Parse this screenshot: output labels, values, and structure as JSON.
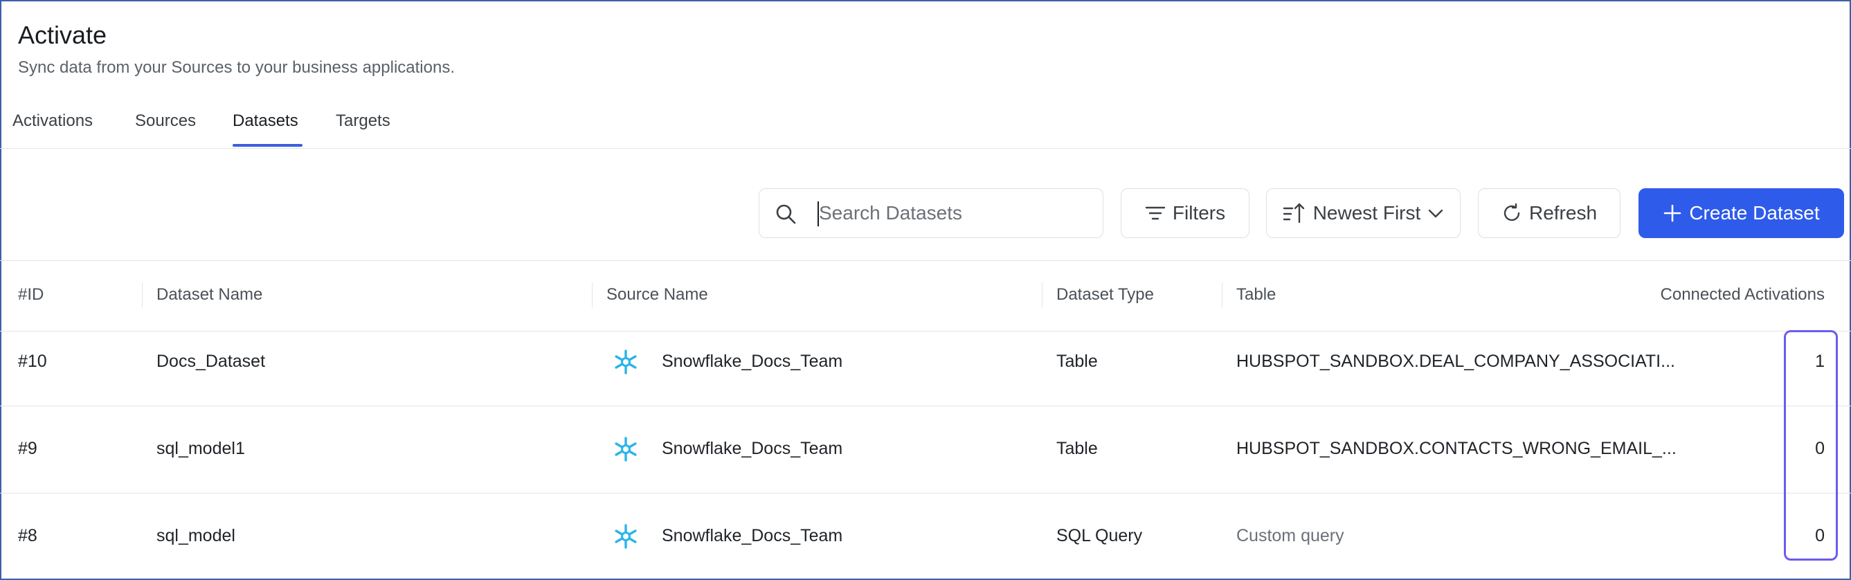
{
  "header": {
    "title": "Activate",
    "subtitle": "Sync data from your Sources to your business applications."
  },
  "tabs": [
    {
      "label": "Activations",
      "active": false
    },
    {
      "label": "Sources",
      "active": false
    },
    {
      "label": "Datasets",
      "active": true
    },
    {
      "label": "Targets",
      "active": false
    }
  ],
  "toolbar": {
    "search_placeholder": "Search Datasets",
    "filters_label": "Filters",
    "sort_label": "Newest First",
    "refresh_label": "Refresh",
    "create_label": "Create Dataset"
  },
  "table": {
    "columns": [
      "#ID",
      "Dataset Name",
      "Source Name",
      "Dataset Type",
      "Table",
      "Connected Activations"
    ],
    "rows": [
      {
        "id": "#10",
        "name": "Docs_Dataset",
        "source": "Snowflake_Docs_Team",
        "type": "Table",
        "table": "HUBSPOT_SANDBOX.DEAL_COMPANY_ASSOCIATI...",
        "activations": "1"
      },
      {
        "id": "#9",
        "name": "sql_model1",
        "source": "Snowflake_Docs_Team",
        "type": "Table",
        "table": "HUBSPOT_SANDBOX.CONTACTS_WRONG_EMAIL_...",
        "activations": "0"
      },
      {
        "id": "#8",
        "name": "sql_model",
        "source": "Snowflake_Docs_Team",
        "type": "SQL Query",
        "table": "Custom query",
        "activations": "0"
      }
    ]
  },
  "icons": {
    "search": "search-icon",
    "filters": "filter-icon",
    "sort": "sort-icon",
    "chevron": "chevron-down-icon",
    "refresh": "refresh-icon",
    "create": "plus-icon",
    "source": "snowflake-icon"
  },
  "colors": {
    "accent": "#2f5bea",
    "tab_underline": "#3c5fe0",
    "highlight": "#6a5cf0",
    "snowflake": "#29b5e8"
  }
}
